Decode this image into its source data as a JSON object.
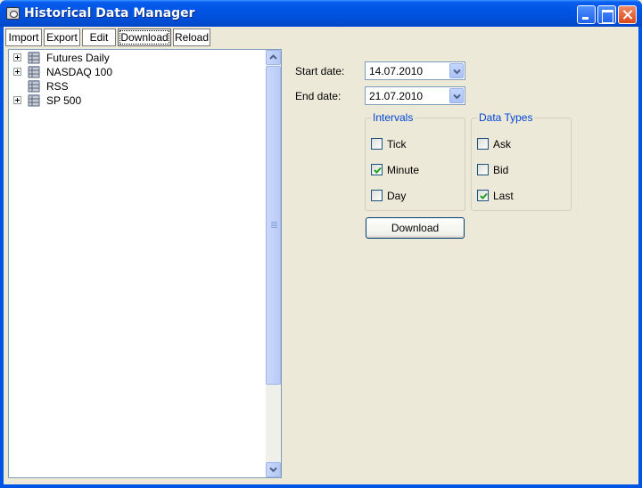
{
  "window": {
    "title": "Historical Data Manager"
  },
  "toolbar": {
    "buttons": [
      {
        "label": "Import"
      },
      {
        "label": "Export"
      },
      {
        "label": "Edit"
      },
      {
        "label": "Download",
        "pressed": true
      },
      {
        "label": "Reload"
      }
    ]
  },
  "tree": {
    "items": [
      {
        "label": "Futures Daily",
        "expandable": true
      },
      {
        "label": "NASDAQ 100",
        "expandable": true
      },
      {
        "label": "RSS",
        "expandable": false
      },
      {
        "label": "SP 500",
        "expandable": true
      }
    ]
  },
  "download": {
    "start_label": "Start date:",
    "start_value": "14.07.2010",
    "end_label": "End date:",
    "end_value": "21.07.2010",
    "intervals": {
      "title": "Intervals",
      "options": [
        {
          "label": "Tick",
          "checked": false
        },
        {
          "label": "Minute",
          "checked": true
        },
        {
          "label": "Day",
          "checked": false
        }
      ]
    },
    "data_types": {
      "title": "Data Types",
      "options": [
        {
          "label": "Ask",
          "checked": false
        },
        {
          "label": "Bid",
          "checked": false
        },
        {
          "label": "Last",
          "checked": true
        }
      ]
    },
    "button_label": "Download"
  },
  "colors": {
    "titlebar": "#0054e3",
    "group_title": "#0046d5",
    "background": "#ece9d8",
    "check_mark": "#21a121"
  }
}
